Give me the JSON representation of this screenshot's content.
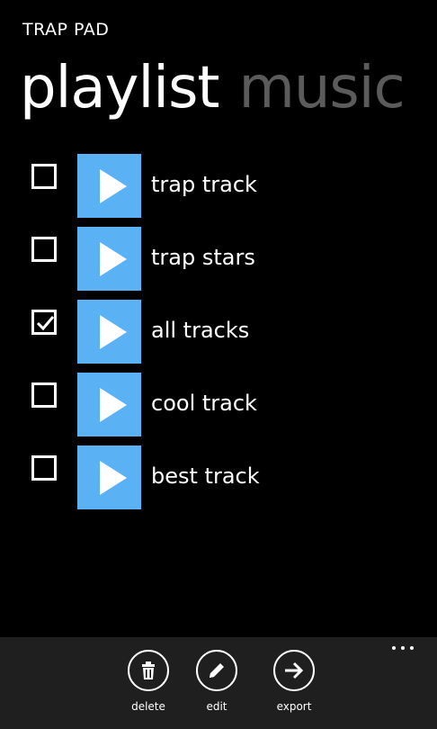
{
  "app": {
    "title": "TRAP PAD"
  },
  "pivot": {
    "tabs": [
      {
        "label": "playlist",
        "active": true
      },
      {
        "label": "music",
        "active": false
      }
    ]
  },
  "tracks": [
    {
      "name": "trap track",
      "checked": false
    },
    {
      "name": "trap stars",
      "checked": false
    },
    {
      "name": "all tracks",
      "checked": true
    },
    {
      "name": "cool track",
      "checked": false
    },
    {
      "name": "best track",
      "checked": false
    }
  ],
  "app_bar": {
    "buttons": [
      {
        "label": "delete",
        "icon": "trash-icon"
      },
      {
        "label": "edit",
        "icon": "pencil-icon"
      },
      {
        "label": "export",
        "icon": "arrow-right-icon"
      }
    ],
    "more_icon": "ellipsis-icon"
  },
  "colors": {
    "background": "#000000",
    "accent": "#5ab1f3",
    "inactive_tab": "#5b5b5b",
    "app_bar": "#1f1f1f"
  }
}
